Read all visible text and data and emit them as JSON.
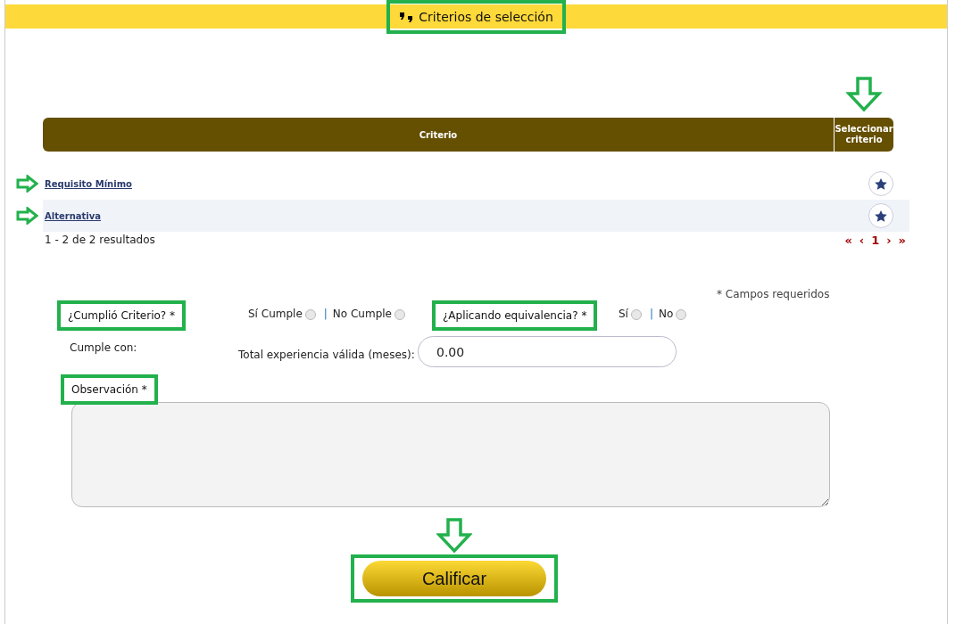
{
  "header": {
    "title": "Criterios de selección",
    "highlighted": true
  },
  "table": {
    "columns": [
      {
        "label": "Criterio",
        "arrow": false
      },
      {
        "label": "Seleccionar criterio",
        "arrow": true
      }
    ],
    "rows": [
      {
        "link": "Requisito Mínimo",
        "arrow": true,
        "striped": false
      },
      {
        "link": "Alternativa",
        "arrow": true,
        "striped": true
      }
    ],
    "summary": "1 - 2 de 2 resultados",
    "pager": {
      "first": "«",
      "prev": "‹",
      "page": "1",
      "next": "›",
      "last": "»"
    }
  },
  "form": {
    "required_note": "* Campos requeridos",
    "cumplio": {
      "label": "¿Cumplió Criterio? *",
      "highlighted": true,
      "separator": "|",
      "options": [
        {
          "label": "Sí Cumple",
          "selected": false
        },
        {
          "label": "No Cumple",
          "selected": false
        }
      ]
    },
    "equivalencia": {
      "label": "¿Aplicando equivalencia? *",
      "highlighted": true,
      "separator": "|",
      "options": [
        {
          "label": "Sí",
          "selected": false
        },
        {
          "label": "No",
          "selected": false
        }
      ]
    },
    "cumple_con": {
      "label": "Cumple con:"
    },
    "experiencia": {
      "label": "Total experiencia válida (meses):",
      "value": "0.00"
    },
    "observacion": {
      "label": "Observación *",
      "highlighted": true
    },
    "submit": {
      "label": "Calificar",
      "highlighted": true,
      "arrow": true
    }
  }
}
